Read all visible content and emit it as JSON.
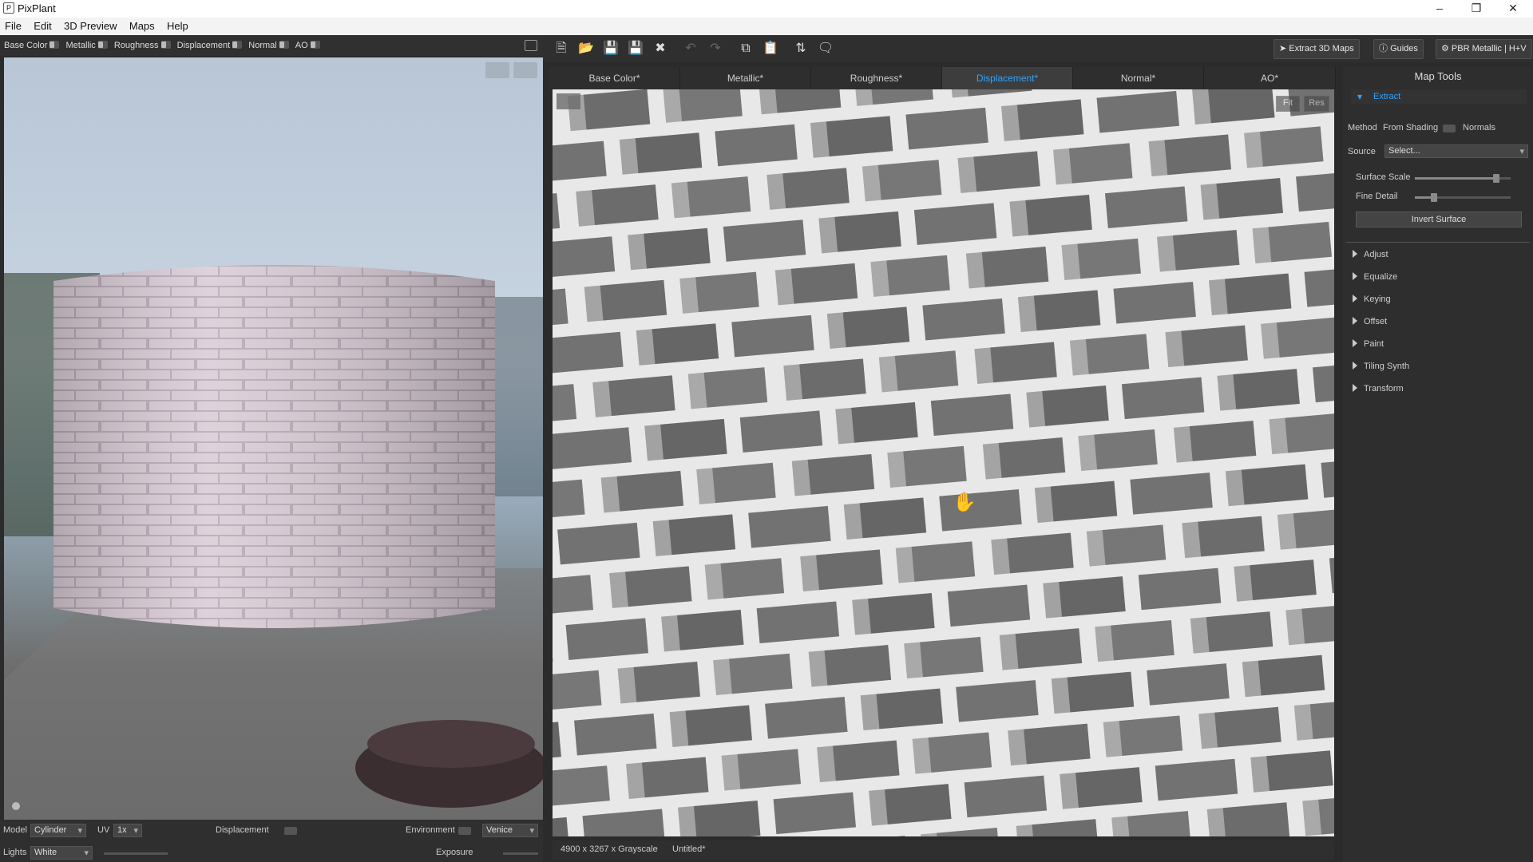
{
  "app": {
    "title": "PixPlant"
  },
  "window_controls": {
    "minimize": "–",
    "restore": "❐",
    "close": "✕"
  },
  "menu": [
    "File",
    "Edit",
    "3D Preview",
    "Maps",
    "Help"
  ],
  "map_toggles": [
    "Base Color",
    "Metallic",
    "Roughness",
    "Displacement",
    "Normal",
    "AO"
  ],
  "preview": {
    "model_label": "Model",
    "model_value": "Cylinder",
    "uv_label": "UV",
    "uv_value": "1x",
    "displacement_label": "Displacement",
    "environment_label": "Environment",
    "environment_value": "Venice",
    "lights_label": "Lights",
    "lights_value": "White",
    "exposure_label": "Exposure"
  },
  "toolbar": {
    "extract_label": "Extract 3D Maps",
    "guides_label": "Guides",
    "pbr_label": "PBR Metallic | H+V"
  },
  "tabs": [
    {
      "label": "Base Color*",
      "active": false
    },
    {
      "label": "Metallic*",
      "active": false
    },
    {
      "label": "Roughness*",
      "active": false
    },
    {
      "label": "Displacement*",
      "active": true
    },
    {
      "label": "Normal*",
      "active": false
    },
    {
      "label": "AO*",
      "active": false
    }
  ],
  "mapview": {
    "fit_label": "Fit",
    "res_label": "Res"
  },
  "status": {
    "dimensions": "4900 x 3267 x Grayscale",
    "file": "Untitled*"
  },
  "map_tools": {
    "title": "Map Tools",
    "section": "Extract",
    "method_label": "Method",
    "method_left": "From Shading",
    "method_right": "Normals",
    "source_label": "Source",
    "source_value": "Select...",
    "surface_scale_label": "Surface Scale",
    "surface_scale_value": 0.85,
    "fine_detail_label": "Fine Detail",
    "fine_detail_value": 0.2,
    "invert_label": "Invert Surface",
    "collapsed": [
      "Adjust",
      "Equalize",
      "Keying",
      "Offset",
      "Paint",
      "Tiling Synth",
      "Transform"
    ]
  },
  "colors": {
    "accent": "#2fa3ff",
    "panel": "#2e2e2e",
    "window": "#2b2b2b"
  }
}
